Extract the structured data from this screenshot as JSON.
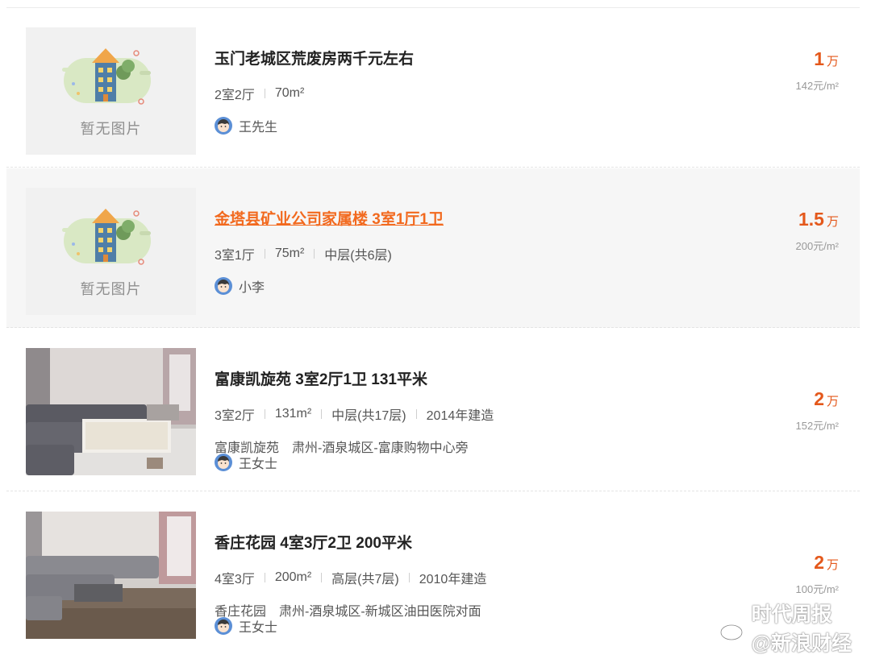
{
  "listings": [
    {
      "title": "玉门老城区荒废房两千元左右",
      "meta": [
        "2室2厅",
        "70m²"
      ],
      "address": null,
      "agent": "王先生",
      "price": "1",
      "price_unit": "万",
      "unit_price": "142元/m²",
      "image": {
        "type": "placeholder",
        "text": "暂无图片"
      }
    },
    {
      "title": "金塔县矿业公司家属楼 3室1厅1卫",
      "meta": [
        "3室1厅",
        "75m²",
        "中层(共6层)"
      ],
      "address": null,
      "agent": "小李",
      "price": "1.5",
      "price_unit": "万",
      "unit_price": "200元/m²",
      "image": {
        "type": "placeholder",
        "text": "暂无图片"
      }
    },
    {
      "title": "富康凯旋苑 3室2厅1卫 131平米",
      "meta": [
        "3室2厅",
        "131m²",
        "中层(共17层)",
        "2014年建造"
      ],
      "address": {
        "community": "富康凯旋苑",
        "location": "肃州-酒泉城区-富康购物中心旁"
      },
      "agent": "王女士",
      "price": "2",
      "price_unit": "万",
      "unit_price": "152元/m²",
      "image": {
        "type": "photo"
      }
    },
    {
      "title": "香庄花园 4室3厅2卫 200平米",
      "meta": [
        "4室3厅",
        "200m²",
        "高层(共7层)",
        "2010年建造"
      ],
      "address": {
        "community": "香庄花园",
        "location": "肃州-酒泉城区-新城区油田医院对面"
      },
      "agent": "王女士",
      "price": "2",
      "price_unit": "万",
      "unit_price": "100元/m²",
      "image": {
        "type": "photo"
      }
    }
  ],
  "watermark": {
    "line1": "时代周报",
    "line2": "@新浪财经"
  },
  "colors": {
    "accent": "#e4581b",
    "hover_bg": "#f6f6f6",
    "text": "#222222",
    "muted": "#999999"
  }
}
